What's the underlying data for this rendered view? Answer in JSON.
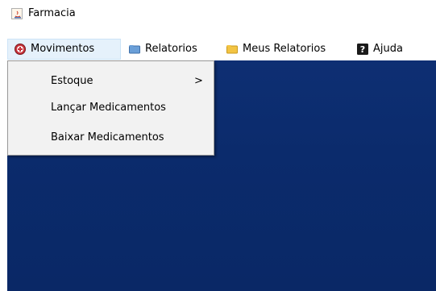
{
  "window": {
    "title": "Farmacia"
  },
  "menubar": {
    "items": [
      {
        "label": "Movimentos",
        "icon": "red-circle-cross-icon"
      },
      {
        "label": "Relatorios",
        "icon": "blue-folder-icon"
      },
      {
        "label": "Meus Relatorios",
        "icon": "yellow-folder-icon"
      },
      {
        "label": "Ajuda",
        "icon": "help-question-icon"
      }
    ]
  },
  "dropdown": {
    "items": [
      {
        "label": "Estoque",
        "submenu_arrow": ">"
      },
      {
        "label": "Lançar Medicamentos"
      },
      {
        "label": "Baixar Medicamentos"
      }
    ]
  },
  "colors": {
    "desktop_background": "#0b2b6c",
    "menu_active_background": "#e5f1fb",
    "dropdown_background": "#f2f2f2"
  }
}
